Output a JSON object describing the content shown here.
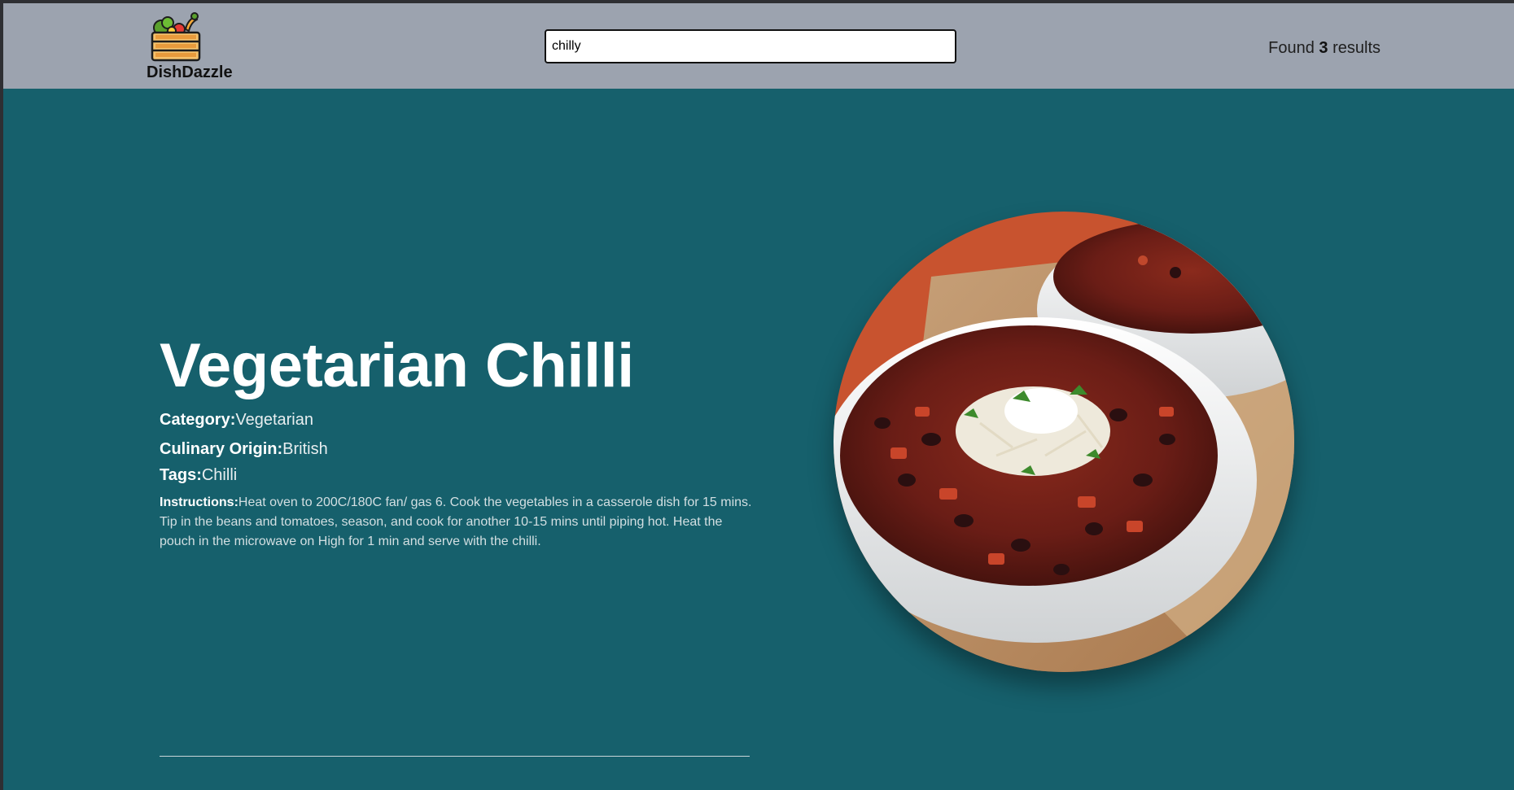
{
  "header": {
    "logo_text": "DishDazzle",
    "search": {
      "value": "chilly",
      "placeholder": ""
    },
    "results": {
      "prefix": "Found",
      "count": "3",
      "suffix": "results"
    }
  },
  "recipe": {
    "title": "Vegetarian Chilli",
    "category_label": "Category:",
    "category": "Vegetarian",
    "origin_label": "Culinary Origin:",
    "origin": "British",
    "tags_label": "Tags:",
    "tags": "Chilli",
    "instructions_label": "Instructions:",
    "instructions": "Heat oven to 200C/180C fan/ gas 6. Cook the vegetables in a casserole dish for 15 mins. Tip in the beans and tomatoes, season, and cook for another 10-15 mins until piping hot. Heat the pouch in the microwave on High for 1 min and serve with the chilli."
  },
  "icons": {
    "logo": "vegetable-crate-icon"
  },
  "colors": {
    "header_bg": "#9ca3af",
    "page_bg": "#16606c",
    "text": "#ffffff"
  }
}
